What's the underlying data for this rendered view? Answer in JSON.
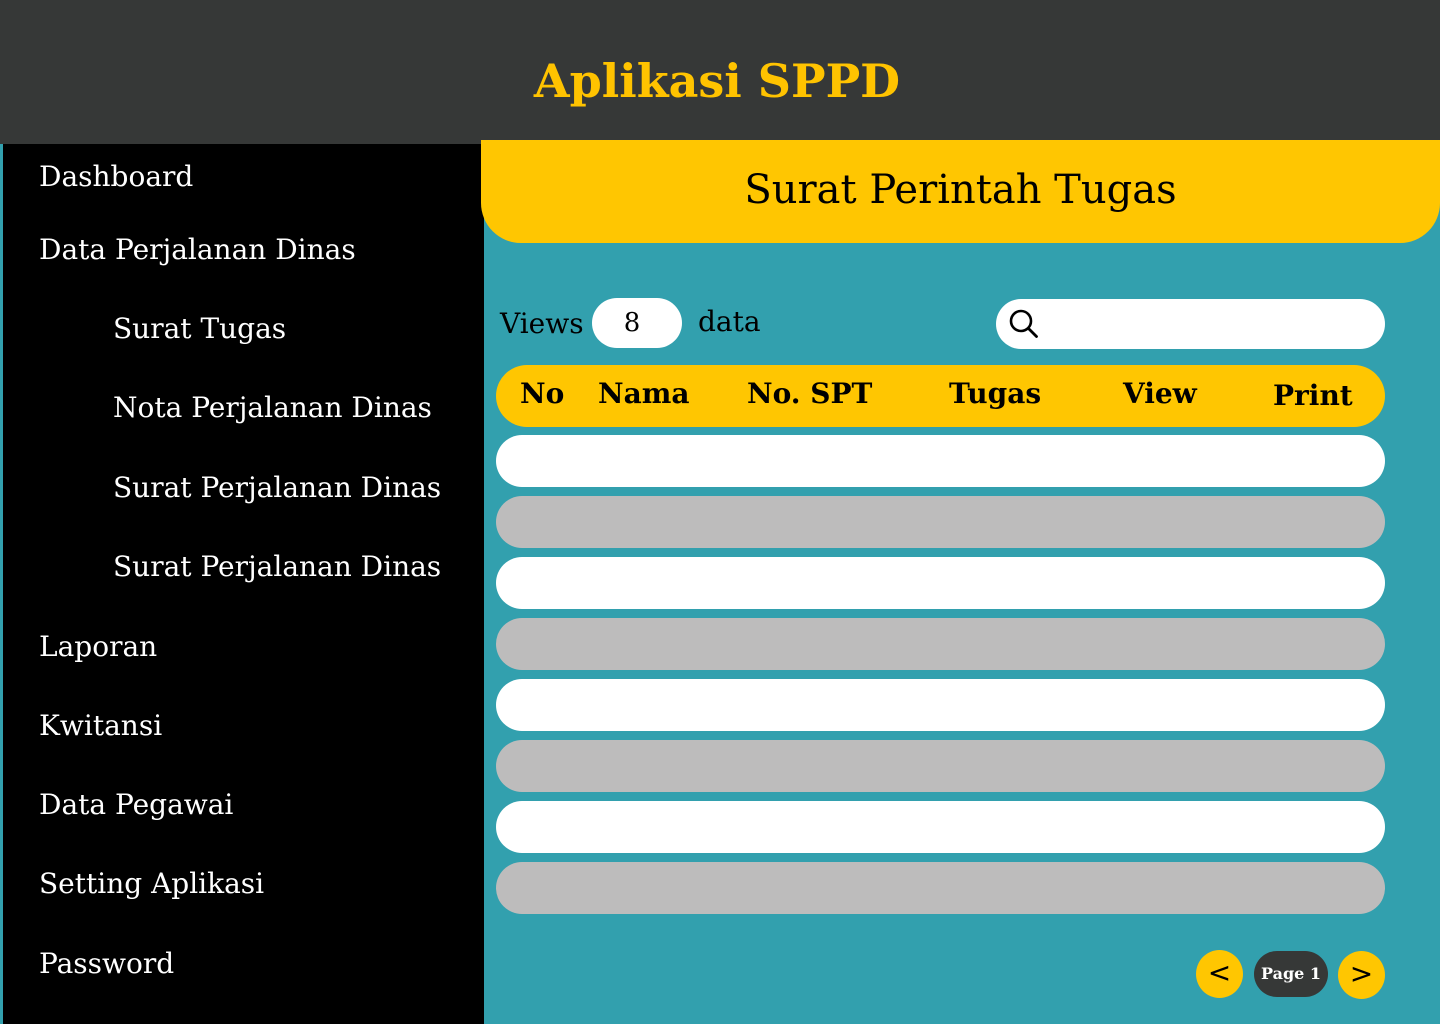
{
  "header": {
    "title": "Aplikasi SPPD"
  },
  "sidebar": {
    "items": [
      {
        "label": "Dashboard"
      },
      {
        "label": "Data Perjalanan Dinas"
      },
      {
        "label": "Surat Tugas"
      },
      {
        "label": "Nota Perjalanan Dinas"
      },
      {
        "label": "Surat Perjalanan Dinas"
      },
      {
        "label": "Surat Perjalanan Dinas"
      },
      {
        "label": "Laporan"
      },
      {
        "label": "Kwitansi"
      },
      {
        "label": "Data Pegawai"
      },
      {
        "label": "Setting Aplikasi"
      },
      {
        "label": "Password"
      }
    ]
  },
  "main": {
    "title": "Surat Perintah Tugas",
    "views_label": "Views",
    "views_value": "8",
    "data_label": "data",
    "search": {
      "value": ""
    },
    "table": {
      "columns": [
        "No",
        "Nama",
        "No. SPT",
        "Tugas",
        "View",
        "Print"
      ],
      "rows": [
        [],
        [],
        [],
        [],
        [],
        [],
        [],
        []
      ]
    },
    "pagination": {
      "prev": "<",
      "page_label": "Page 1",
      "next": ">"
    }
  },
  "colors": {
    "header_bg": "#363837",
    "accent": "#ffc601",
    "content_bg": "#32a0ae",
    "sidebar_bg": "#000000",
    "row_alt": "#bdbcbc"
  }
}
